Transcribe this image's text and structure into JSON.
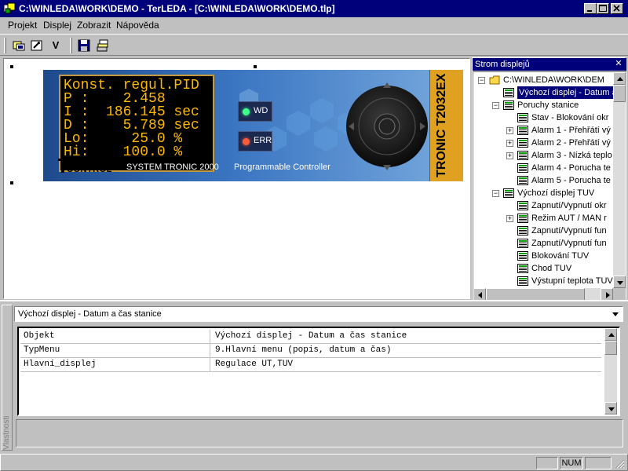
{
  "window": {
    "title": "C:\\WINLEDA\\WORK\\DEMO - TerLEDA - [C:\\WINLEDA\\WORK\\DEMO.tlp]",
    "controls": [
      "minimize",
      "maximize",
      "close"
    ]
  },
  "menu": {
    "items": [
      "Projekt",
      "Displej",
      "Zobrazit",
      "Nápověda"
    ]
  },
  "toolbar": {
    "v_label": "V"
  },
  "device": {
    "lcd_lines": [
      "Konst. regul.PID",
      "P :    2.458",
      "I :  186.145 sec",
      "D :    5.789 sec",
      "Lo:     25.0 %",
      "Hi:    100.0 %"
    ],
    "logo": "TRONIC CONTROL",
    "system_label": "SYSTEM TRONIC 2000",
    "wd_label": "WD",
    "err_label": "ERR",
    "programmable_label": "Programmable Controller",
    "model": "TRONIC T2032EX",
    "colors": {
      "lcd_text": "#ffb800",
      "panel_blue": "#2d5fa6",
      "model_strip": "#e0a020",
      "wd_led": "#3dff8a",
      "err_led": "#ff5a3a"
    }
  },
  "tree": {
    "title": "Strom displejů",
    "items": [
      {
        "label": "C:\\WINLEDA\\WORK\\DEM",
        "icon": "folder-icon",
        "expander": "minus"
      },
      {
        "label": "Výchozí displej - Datum a",
        "icon": "display-icon",
        "selected": true
      },
      {
        "label": "Poruchy stanice",
        "icon": "display-icon",
        "expander": "minus"
      },
      {
        "label": "Stav - Blokování okr",
        "icon": "display-icon"
      },
      {
        "label": "Alarm 1 - Přehřátí vý",
        "icon": "display-icon",
        "expander": "plus"
      },
      {
        "label": "Alarm 2 - Přehřátí vý",
        "icon": "display-icon",
        "expander": "plus"
      },
      {
        "label": "Alarm 3 - Nízká teplo",
        "icon": "display-icon",
        "expander": "plus"
      },
      {
        "label": "Alarm 4 - Porucha te",
        "icon": "display-icon"
      },
      {
        "label": "Alarm 5 - Porucha te",
        "icon": "display-icon"
      },
      {
        "label": "Výchozí displej TUV",
        "icon": "display-icon",
        "expander": "minus"
      },
      {
        "label": "Zapnutí/Vypnutí okr",
        "icon": "display-icon"
      },
      {
        "label": "Režim AUT / MAN r",
        "icon": "display-icon",
        "expander": "plus"
      },
      {
        "label": "Zapnutí/Vypnutí fun",
        "icon": "display-icon"
      },
      {
        "label": "Zapnutí/Vypnutí fun",
        "icon": "display-icon"
      },
      {
        "label": "Blokování TUV",
        "icon": "display-icon"
      },
      {
        "label": "Chod TUV",
        "icon": "display-icon"
      },
      {
        "label": "Výstupní teplota TUV",
        "icon": "display-icon"
      }
    ]
  },
  "properties": {
    "side_title": "Vlastnosti",
    "selected_object": "Výchozí displej - Datum a čas stanice",
    "rows": [
      {
        "key": "Objekt",
        "value": "Výchozí displej - Datum a čas stanice"
      },
      {
        "key": "TypMenu",
        "value": "9.Hlavní menu (popis, datum a čas)"
      },
      {
        "key": "Hlavní_displej",
        "value": "Regulace UT,TUV"
      }
    ]
  },
  "status": {
    "panes": [
      "",
      "NUM",
      ""
    ]
  }
}
